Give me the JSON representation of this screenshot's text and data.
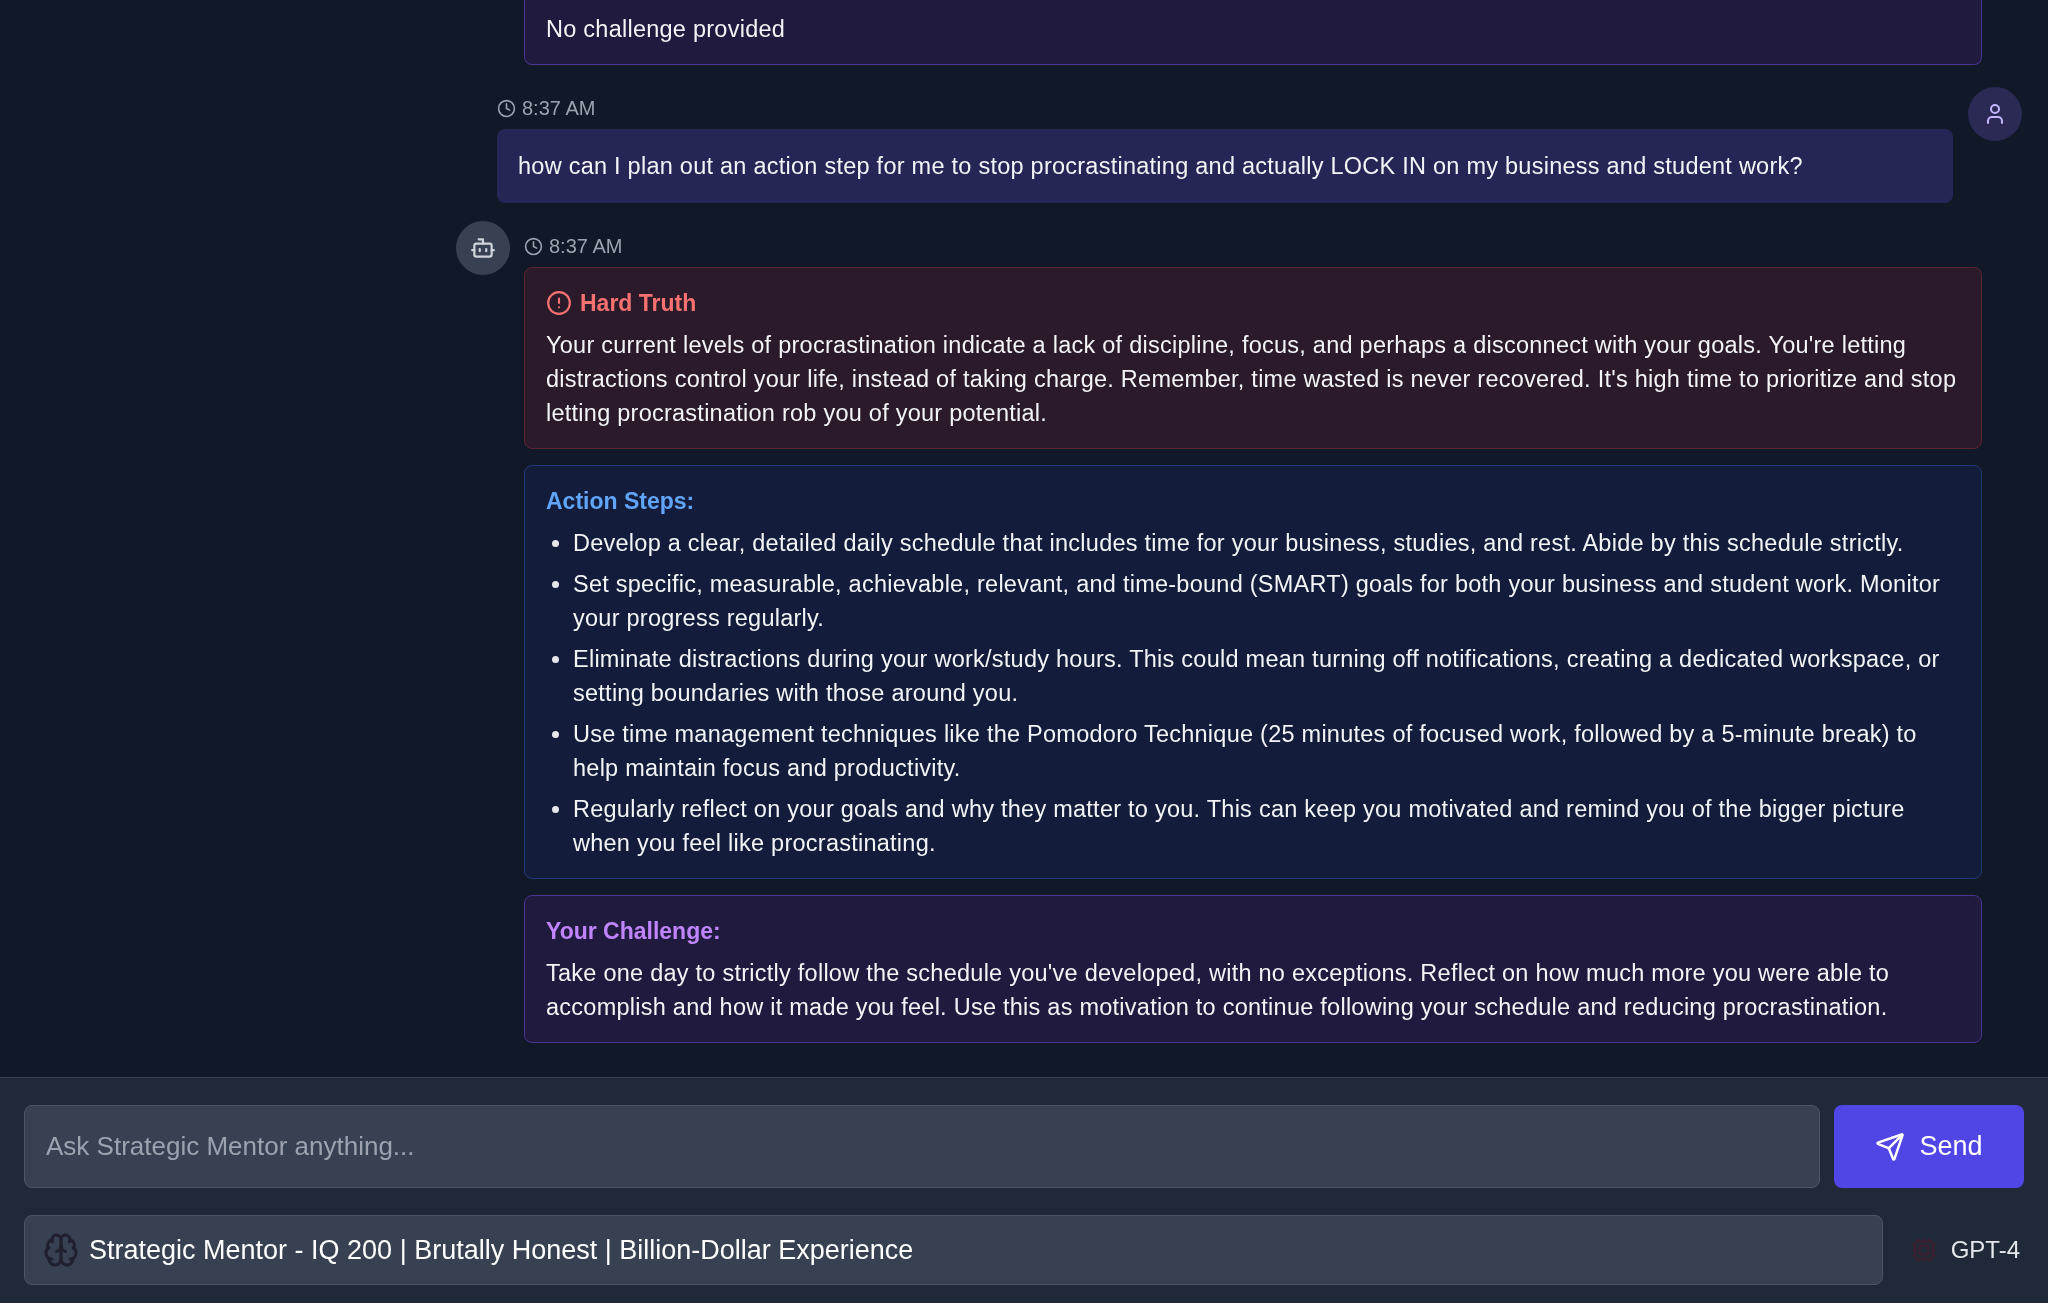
{
  "messages": [
    {
      "kind": "bot_partial",
      "sections": [
        {
          "kind": "challenge",
          "body": "No challenge provided"
        }
      ]
    },
    {
      "kind": "user",
      "time": "8:37 AM",
      "text": "how can I plan out an action step for me to stop procrastinating and actually LOCK IN on my business and student work?"
    },
    {
      "kind": "bot",
      "time": "8:37 AM",
      "sections": [
        {
          "kind": "truth",
          "title": "Hard Truth",
          "body": "Your current levels of procrastination indicate a lack of discipline, focus, and perhaps a disconnect with your goals. You're letting distractions control your life, instead of taking charge. Remember, time wasted is never recovered. It's high time to prioritize and stop letting procrastination rob you of your potential."
        },
        {
          "kind": "steps",
          "title": "Action Steps:",
          "items": [
            "Develop a clear, detailed daily schedule that includes time for your business, studies, and rest. Abide by this schedule strictly.",
            "Set specific, measurable, achievable, relevant, and time-bound (SMART) goals for both your business and student work. Monitor your progress regularly.",
            "Eliminate distractions during your work/study hours. This could mean turning off notifications, creating a dedicated workspace, or setting boundaries with those around you.",
            "Use time management techniques like the Pomodoro Technique (25 minutes of focused work, followed by a 5-minute break) to help maintain focus and productivity.",
            "Regularly reflect on your goals and why they matter to you. This can keep you motivated and remind you of the bigger picture when you feel like procrastinating."
          ]
        },
        {
          "kind": "challenge",
          "title": "Your Challenge:",
          "body": "Take one day to strictly follow the schedule you've developed, with no exceptions. Reflect on how much more you were able to accomplish and how it made you feel. Use this as motivation to continue following your schedule and reducing procrastination."
        }
      ]
    }
  ],
  "composer": {
    "placeholder": "Ask Strategic Mentor anything...",
    "send_label": "Send"
  },
  "mentor_bar": {
    "name": "Strategic Mentor - IQ 200 | Brutally Honest | Billion-Dollar Experience",
    "model": "GPT-4"
  }
}
